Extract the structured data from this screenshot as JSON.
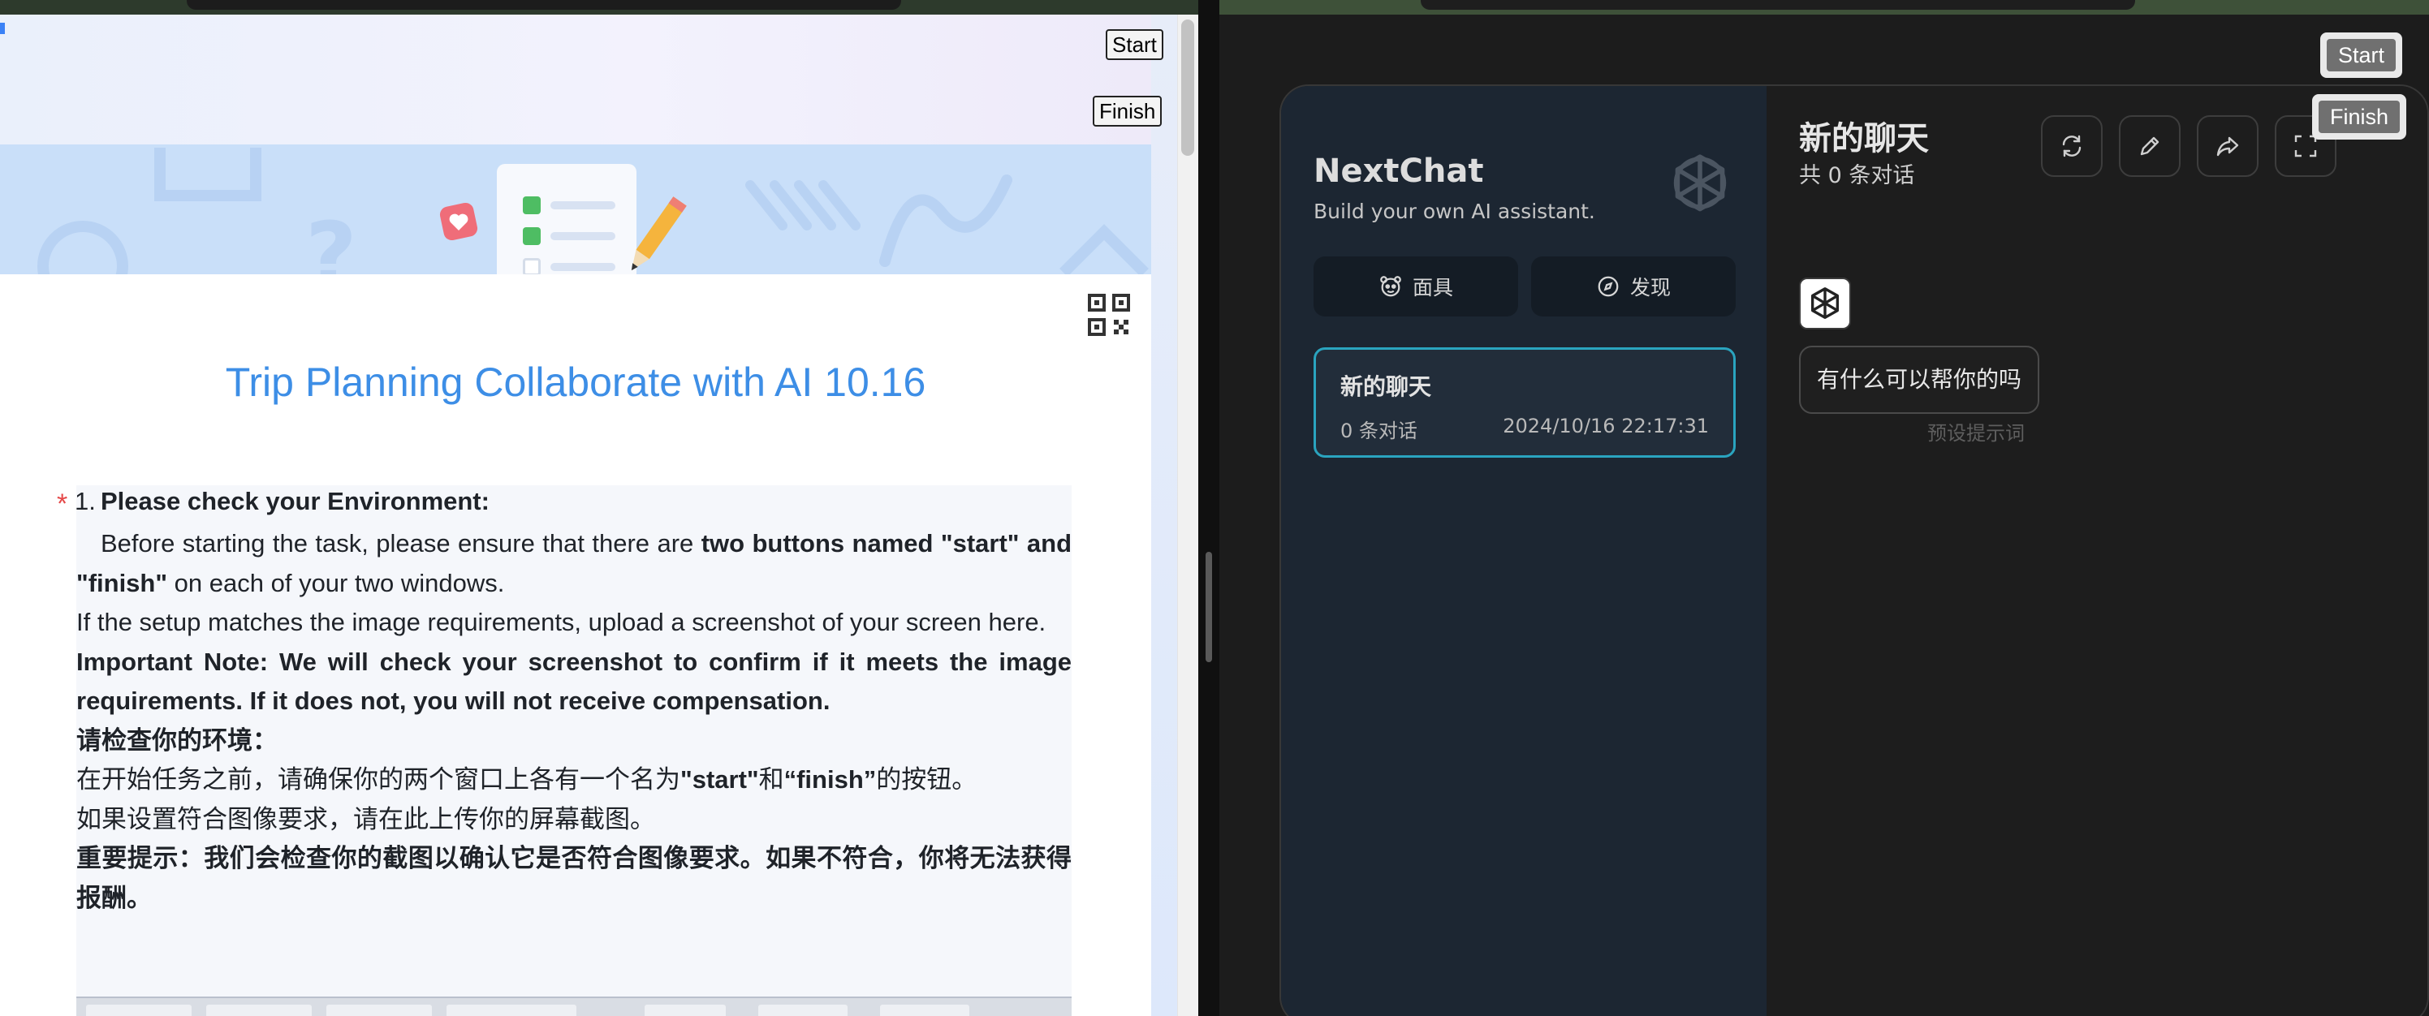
{
  "left": {
    "overlay": {
      "start_label": "Start",
      "finish_label": "Finish"
    },
    "form_title": "Trip Planning Collaborate with AI 10.16",
    "question": {
      "required_mark": "*",
      "number": "1.",
      "title": "Please check your Environment:",
      "line1_plain": "Before starting the task, please ensure that there are ",
      "line1_bold": "two buttons named \"start\" and \"finish\"",
      "line1_tail": " on each of your two windows.",
      "line2": "If the setup matches the image requirements, upload a screenshot of your screen here.",
      "line3_bold": "Important Note: We will check your screenshot to confirm if it meets the image requirements. If it does not, you will not receive compensation.",
      "zh_heading": "请检查你的环境：",
      "zh_line1_a": "在开始任务之前，请确保你的两个窗口上各有一个名为",
      "zh_line1_b": "\"start\"",
      "zh_line1_c": "和",
      "zh_line1_d": "“finish”",
      "zh_line1_e": "的按钮。",
      "zh_line2": "如果设置符合图像要求，请在此上传你的屏幕截图。",
      "zh_line3_bold": "重要提示：我们会检查你的截图以确认它是否符合图像要求。如果不符合，你将无法获得报酬。"
    }
  },
  "right": {
    "overlay": {
      "start_label": "Start",
      "finish_label": "Finish"
    },
    "brand": {
      "title": "NextChat",
      "subtitle": "Build your own AI assistant."
    },
    "sidebar_buttons": {
      "masks_label": "面具",
      "discover_label": "发现"
    },
    "chat_item": {
      "title": "新的聊天",
      "count": "0 条对话",
      "time": "2024/10/16 22:17:31"
    },
    "chat": {
      "title": "新的聊天",
      "subtitle": "共 0 条对话",
      "bot_message": "有什么可以帮你的吗",
      "bot_message_caption": "预设提示词"
    },
    "toolbar_icons": [
      "refresh-icon",
      "edit-icon",
      "share-icon",
      "fullscreen-icon"
    ]
  },
  "colors": {
    "form_title": "#3d8ee6",
    "required_star": "#e54848",
    "chat_item_border": "#2aa4bf",
    "sidebar_bg": "#1c2632"
  }
}
